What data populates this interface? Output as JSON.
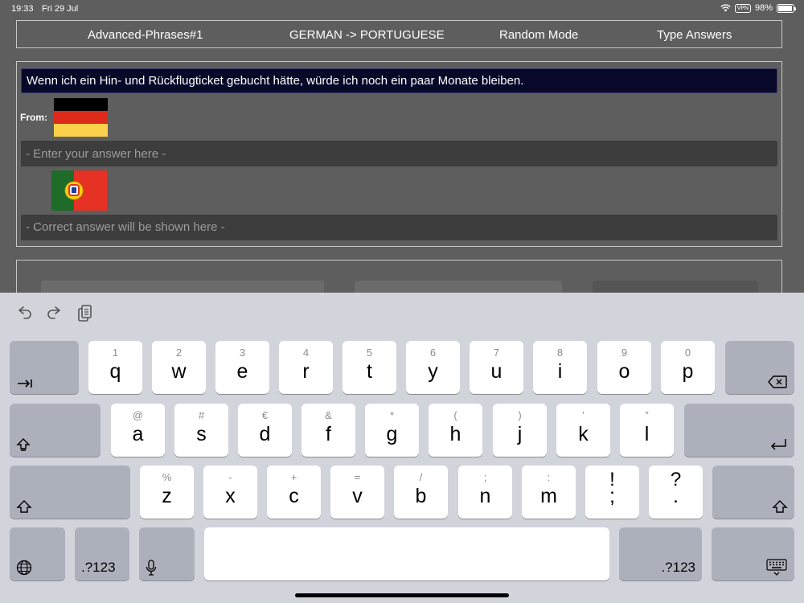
{
  "status": {
    "time": "19:33",
    "date": "Fri 29 Jul",
    "vpn": "VPN",
    "battery": "98%",
    "battery_level": 0.98
  },
  "menu": {
    "deck": "Advanced-Phrases#1",
    "direction": "GERMAN -> PORTUGUESE",
    "mode": "Random Mode",
    "answer_type": "Type Answers"
  },
  "quiz": {
    "question": "Wenn ich ein Hin- und Rückflugticket gebucht hätte, würde ich noch ein paar Monate bleiben.",
    "from_label": "From:",
    "source_flag": "german-flag",
    "target_flag": "portuguese-flag",
    "answer_placeholder": "- Enter your answer here -",
    "answer_value": "",
    "correct_placeholder": "- Correct answer will be shown here -"
  },
  "keyboard": {
    "toolbar": [
      "undo-icon",
      "redo-icon",
      "clipboard-icon"
    ],
    "row1": [
      {
        "main": "q",
        "alt": "1"
      },
      {
        "main": "w",
        "alt": "2"
      },
      {
        "main": "e",
        "alt": "3"
      },
      {
        "main": "r",
        "alt": "4"
      },
      {
        "main": "t",
        "alt": "5"
      },
      {
        "main": "y",
        "alt": "6"
      },
      {
        "main": "u",
        "alt": "7"
      },
      {
        "main": "i",
        "alt": "8"
      },
      {
        "main": "o",
        "alt": "9"
      },
      {
        "main": "p",
        "alt": "0"
      }
    ],
    "row2": [
      {
        "main": "a",
        "alt": "@"
      },
      {
        "main": "s",
        "alt": "#"
      },
      {
        "main": "d",
        "alt": "€"
      },
      {
        "main": "f",
        "alt": "&"
      },
      {
        "main": "g",
        "alt": "*"
      },
      {
        "main": "h",
        "alt": "("
      },
      {
        "main": "j",
        "alt": ")"
      },
      {
        "main": "k",
        "alt": "’"
      },
      {
        "main": "l",
        "alt": "”"
      }
    ],
    "row3": [
      {
        "main": "z",
        "alt": "%"
      },
      {
        "main": "x",
        "alt": "-"
      },
      {
        "main": "c",
        "alt": "+"
      },
      {
        "main": "v",
        "alt": "="
      },
      {
        "main": "b",
        "alt": "/"
      },
      {
        "main": "n",
        "alt": ";"
      },
      {
        "main": "m",
        "alt": ":"
      },
      {
        "main": ";",
        "alt": "!"
      },
      {
        "main": ".",
        "alt": "?"
      }
    ],
    "numbers_label_left": ".?123",
    "numbers_label_right": ".?123",
    "space_label": ""
  }
}
